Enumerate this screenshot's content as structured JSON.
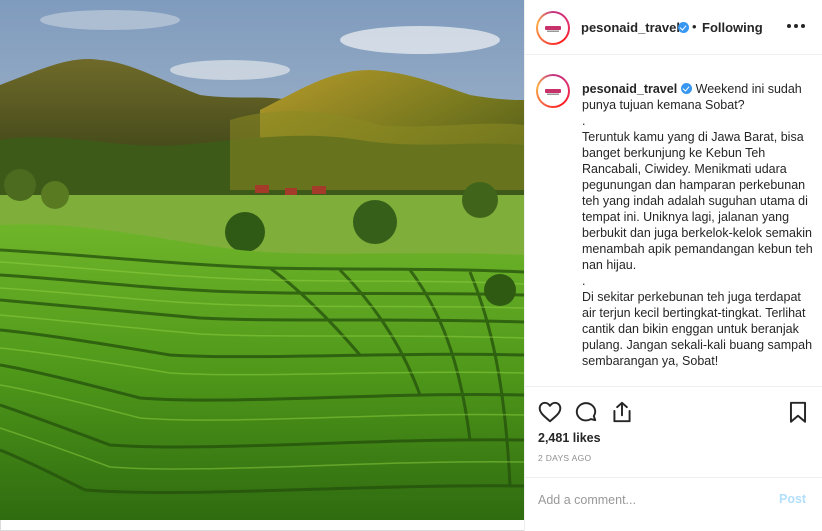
{
  "photo": {
    "alt_scene": "tea-plantation-landscape",
    "colors": {
      "sky": "#9bb3cc",
      "hill": "#4e5a22",
      "tea_bright": "#5ea51c",
      "tea_dark": "#2b5410"
    }
  },
  "header": {
    "username": "pesonaid_travel",
    "separator": "•",
    "follow_status": "Following",
    "more_icon": "more-horizontal-icon",
    "verified_icon": "verified-badge-icon"
  },
  "caption": {
    "username": "pesonaid_travel",
    "text": " Weekend ini sudah punya tujuan kemana Sobat?\n.\nTeruntuk kamu yang di Jawa Barat, bisa banget berkunjung ke Kebun Teh Rancabali, Ciwidey. Menikmati udara pegunungan dan hamparan perkebunan teh yang indah adalah suguhan utama di tempat ini. Uniknya lagi, jalanan yang berbukit dan juga berkelok-kelok semakin menambah apik pemandangan kebun teh nan hijau.\n.\nDi sekitar perkebunan teh juga terdapat air terjun kecil bertingkat-tingkat. Terlihat cantik dan bikin enggan untuk beranjak pulang. Jangan sekali-kali buang sampah sembarangan ya, Sobat!"
  },
  "actions": {
    "like_icon": "heart-icon",
    "comment_icon": "comment-icon",
    "share_icon": "share-icon",
    "save_icon": "bookmark-icon"
  },
  "stats": {
    "likes": "2,481 likes",
    "time": "2 DAYS AGO"
  },
  "comment": {
    "placeholder": "Add a comment...",
    "post_label": "Post",
    "post_color": "#b2dffc"
  },
  "colors": {
    "accent": "#3897f0",
    "border": "#efefef",
    "muted": "#8e8e8e"
  }
}
